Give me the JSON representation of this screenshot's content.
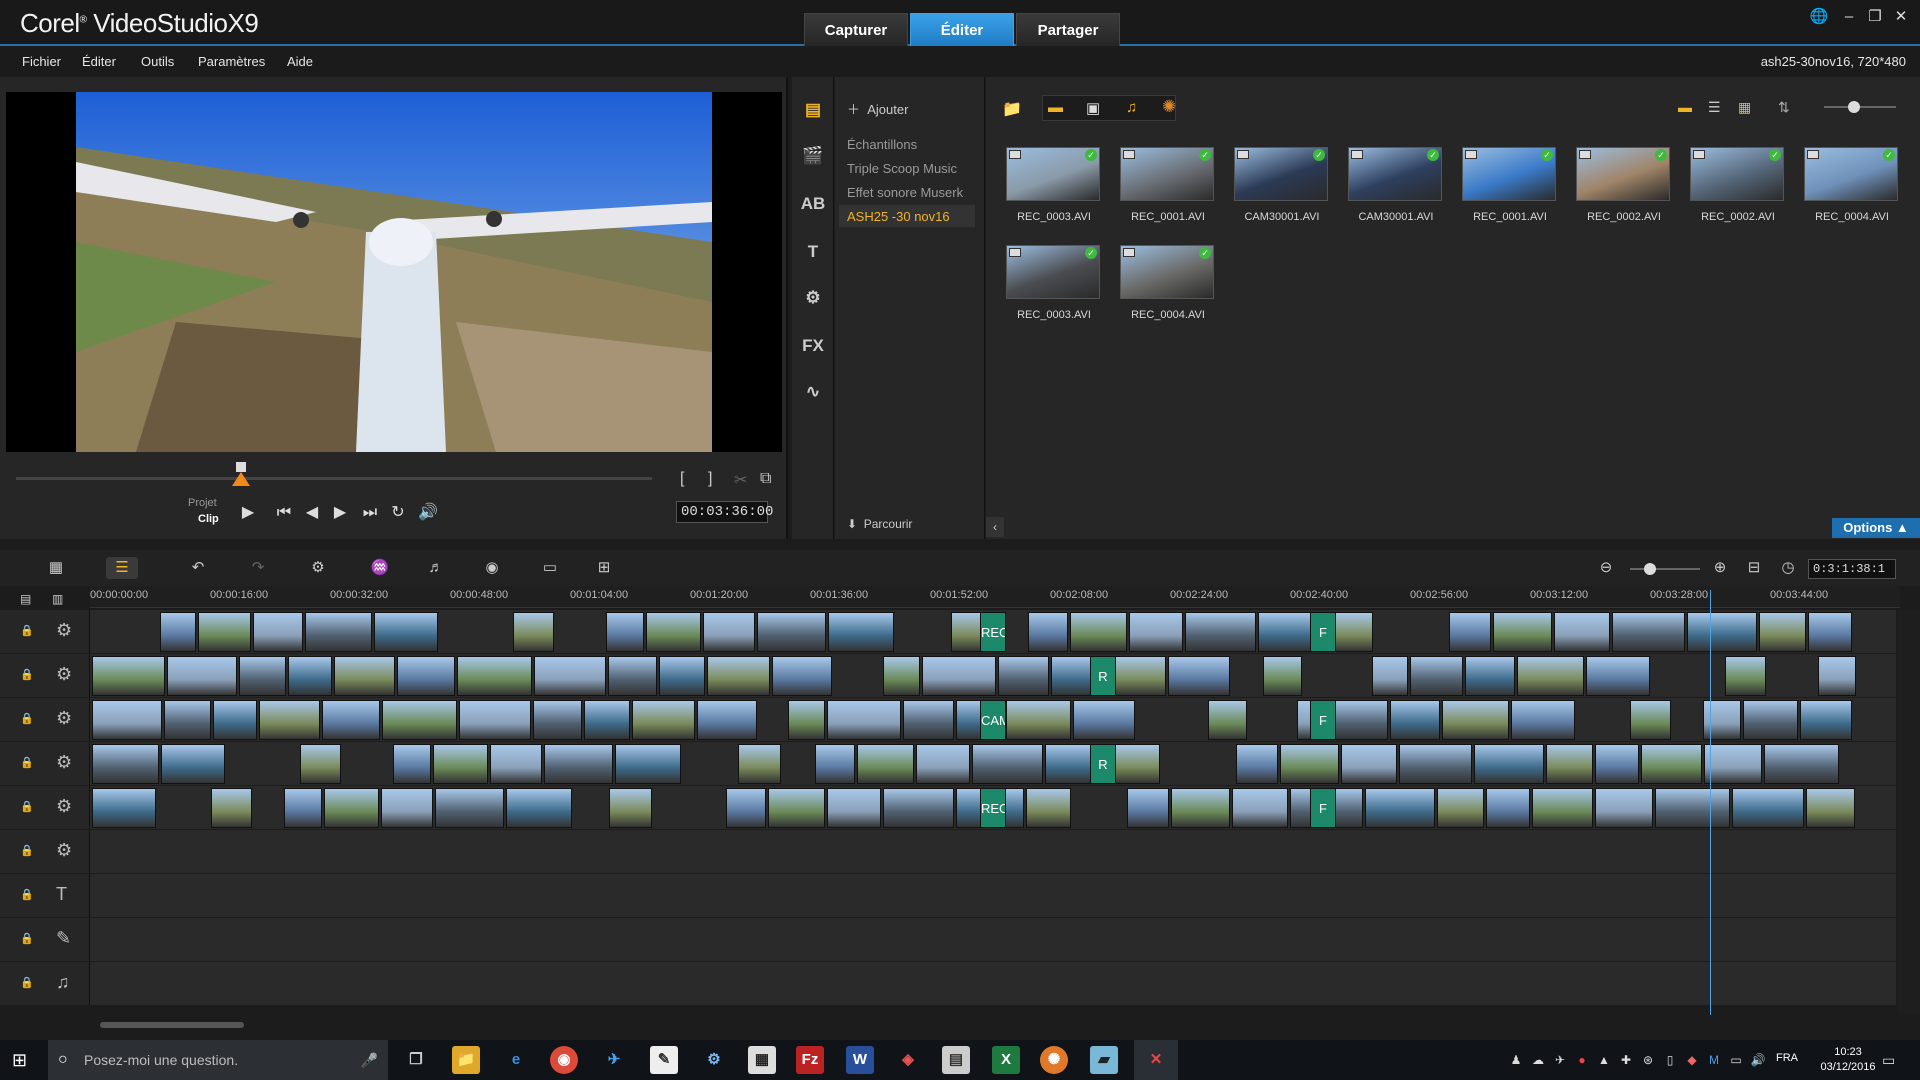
{
  "app": {
    "brand": "Corel",
    "product": "VideoStudio",
    "version": "X9"
  },
  "tabs": [
    {
      "label": "Capturer"
    },
    {
      "label": "Éditer"
    },
    {
      "label": "Partager"
    }
  ],
  "menu": [
    {
      "label": "Fichier"
    },
    {
      "label": "Éditer"
    },
    {
      "label": "Outils"
    },
    {
      "label": "Paramètres"
    },
    {
      "label": "Aide"
    }
  ],
  "project_info": "ash25-30nov16, 720*480",
  "player": {
    "mode_project": "Projet",
    "mode_clip": "Clip",
    "timecode": "00:03:36:00"
  },
  "library": {
    "add_label": "Ajouter",
    "browse_label": "Parcourir",
    "options_label": "Options",
    "folders": [
      {
        "label": "Échantillons"
      },
      {
        "label": "Triple Scoop Music"
      },
      {
        "label": "Effet sonore Muserk"
      },
      {
        "label": "ASH25 -30 nov16"
      }
    ],
    "media": [
      {
        "name": "REC_0003.AVI",
        "color": "#8a9aa8"
      },
      {
        "name": "REC_0001.AVI",
        "color": "#6a6f75"
      },
      {
        "name": "CAM30001.AVI",
        "color": "#2b3a55"
      },
      {
        "name": "CAM30001.AVI",
        "color": "#2e3f5e"
      },
      {
        "name": "REC_0001.AVI",
        "color": "#3a7ac8"
      },
      {
        "name": "REC_0002.AVI",
        "color": "#a08468"
      },
      {
        "name": "REC_0002.AVI",
        "color": "#556678"
      },
      {
        "name": "REC_0004.AVI",
        "color": "#6f90b8"
      },
      {
        "name": "REC_0003.AVI",
        "color": "#4a4c50"
      },
      {
        "name": "REC_0004.AVI",
        "color": "#6a6a68"
      }
    ]
  },
  "timeline": {
    "zoom_timecode": "0:3:1:38:1",
    "ruler": [
      "00:00:00:00",
      "00:00:16:00",
      "00:00:32:00",
      "00:00:48:00",
      "00:01:04:00",
      "00:01:20:00",
      "00:01:36:00",
      "00:01:52:00",
      "00:02:08:00",
      "00:02:24:00",
      "00:02:40:00",
      "00:02:56:00",
      "00:03:12:00",
      "00:03:28:00",
      "00:03:44:00"
    ],
    "clip_labels": {
      "rec": "REC",
      "cam": "CAM",
      "r": "R",
      "c": "C",
      "f": "F"
    }
  },
  "taskbar": {
    "search_placeholder": "Posez-moi une question.",
    "lang": "FRA",
    "time": "10:23",
    "date": "03/12/2016"
  }
}
